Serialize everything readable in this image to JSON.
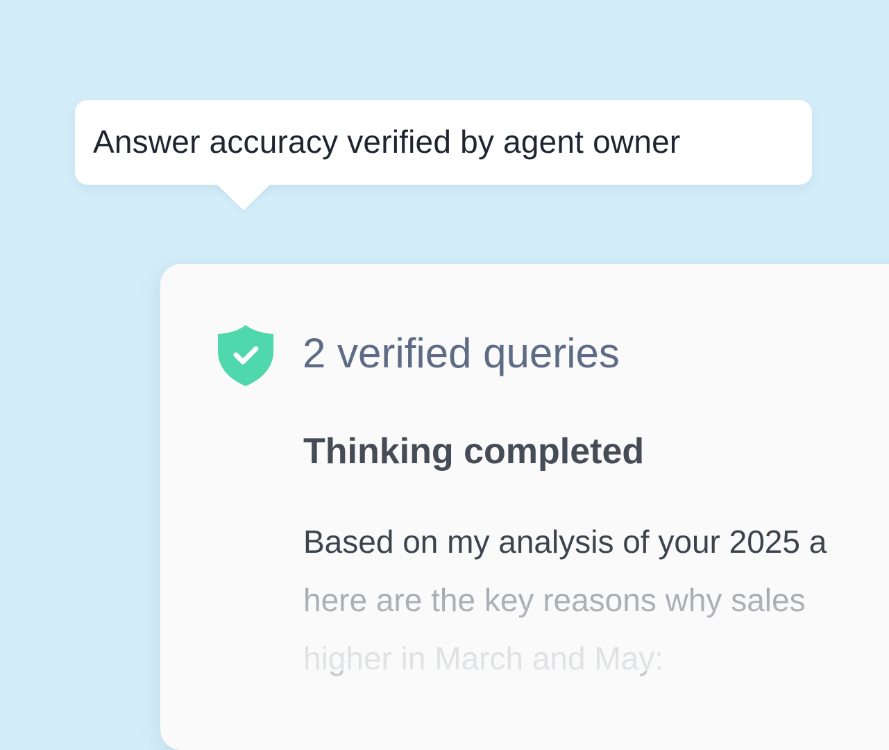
{
  "tooltip": {
    "text": "Answer accuracy verified by agent owner"
  },
  "card": {
    "verified_label": "2 verified queries",
    "verified_icon": "shield-check-icon",
    "status_heading": "Thinking completed",
    "answer_lines": [
      "Based on my analysis of your 2025 a",
      "here are the key reasons why sales",
      "higher in March and May:"
    ]
  },
  "colors": {
    "background": "#d4eef9",
    "shield": "#4fd8ab",
    "verified_text": "#5e6b84",
    "heading_text": "#464c56"
  }
}
